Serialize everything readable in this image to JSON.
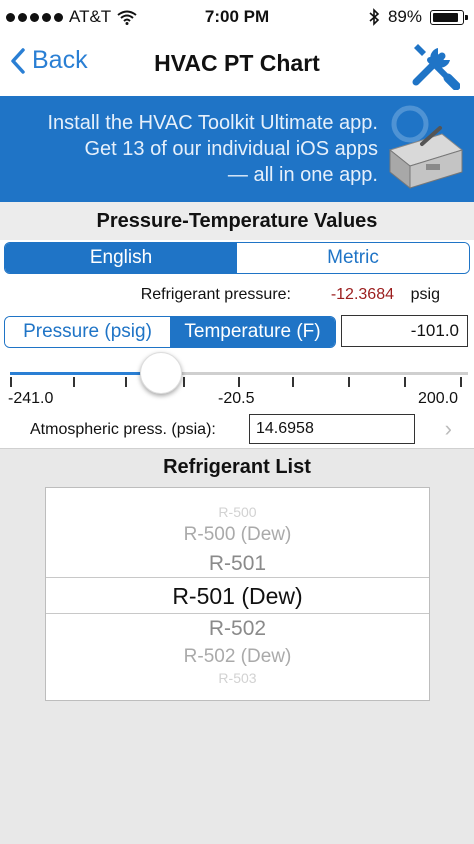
{
  "status": {
    "carrier": "AT&T",
    "time": "7:00 PM",
    "battery": "89%"
  },
  "nav": {
    "back_label": "Back",
    "title": "HVAC PT Chart",
    "tools_icon": "wrench-screwdriver-icon"
  },
  "banner": {
    "line1": "Install the HVAC Toolkit Ultimate app.",
    "line2": "Get 13 of our individual iOS apps",
    "line3": "— all in one app.",
    "icon": "toolbox-icon"
  },
  "pt": {
    "title": "Pressure-Temperature Values",
    "units": [
      {
        "label": "English",
        "selected": true
      },
      {
        "label": "Metric",
        "selected": false
      }
    ],
    "pressure_label": "Refrigerant pressure:",
    "pressure_value": "-12.3684",
    "pressure_unit": "psig",
    "modes": [
      {
        "label": "Pressure (psig)",
        "selected": false
      },
      {
        "label": "Temperature (F)",
        "selected": true
      }
    ],
    "temperature_value": "-101.0",
    "slider": {
      "min_label": "-241.0",
      "mid_label": "-20.5",
      "max_label": "200.0",
      "min": -241.0,
      "max": 200.0,
      "value": -101.0
    },
    "atm_label": "Atmospheric press. (psia):",
    "atm_value": "14.6958"
  },
  "refrigerants": {
    "title": "Refrigerant List",
    "items": [
      "R-500",
      "R-500 (Dew)",
      "R-501",
      "R-501 (Dew)",
      "R-502",
      "R-502 (Dew)",
      "R-503"
    ],
    "selected": "R-501 (Dew)"
  },
  "colors": {
    "accent": "#1f74c6",
    "link": "#2a7fd4",
    "pressure_value": "#9b1d1d"
  }
}
